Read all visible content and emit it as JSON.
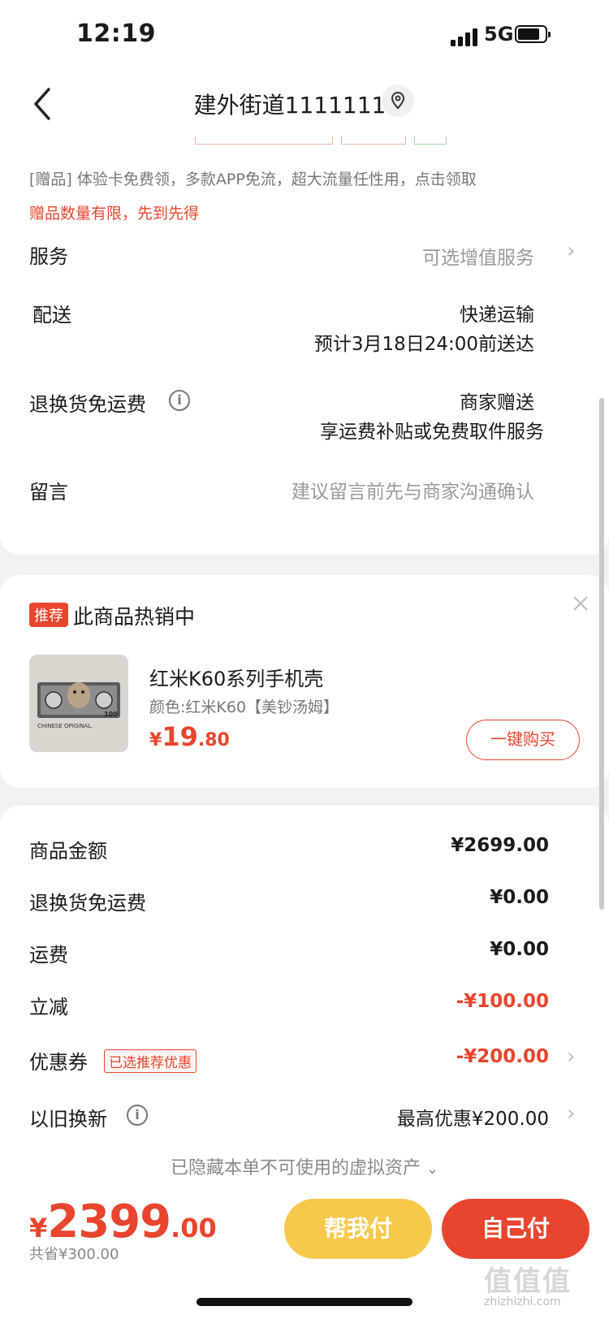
{
  "status": {
    "time": "12:19",
    "network": "5G"
  },
  "nav": {
    "title": "建外街道1111111"
  },
  "details": {
    "gift_text": "[赠品] 体验卡免费领，多款APP免流，超大流量任性用，点击领取",
    "gift_warning": "赠品数量有限，先到先得",
    "service": {
      "label": "服务",
      "value": "可选增值服务"
    },
    "delivery": {
      "label": "配送",
      "method": "快递运输",
      "eta": "预计3月18日24:00前送达"
    },
    "return_shipping": {
      "label": "退换货免运费",
      "line1": "商家赠送",
      "line2": "享运费补贴或免费取件服务"
    },
    "message": {
      "label": "留言",
      "placeholder": "建议留言前先与商家沟通确认"
    }
  },
  "recommend": {
    "badge": "推荐",
    "title": "此商品热销中",
    "product_name": "红米K60系列手机壳",
    "product_color": "颜色:红米K60【美钞汤姆】",
    "price_symbol": "¥",
    "price_int": "19",
    "price_dec": ".80",
    "buy_label": "一键购买",
    "thumb_text": "CHINESE OPIGINAL.",
    "thumb_value": "100"
  },
  "amounts": {
    "rows": [
      {
        "label": "商品金额",
        "value": "¥2699.00"
      },
      {
        "label": "退换货免运费",
        "value": "¥0.00"
      },
      {
        "label": "运费",
        "value": "¥0.00"
      },
      {
        "label": "立减",
        "value": "-¥100.00"
      },
      {
        "label": "优惠券",
        "badge": "已选推荐优惠",
        "value": "-¥200.00"
      },
      {
        "label": "以旧换新",
        "value": "最高优惠¥200.00"
      }
    ],
    "hidden_note": "已隐藏本单不可使用的虚拟资产"
  },
  "bottom": {
    "currency": "¥",
    "total_int": "2399",
    "total_dec": ".00",
    "saved": "共省¥300.00",
    "help_pay": "帮我付",
    "self_pay": "自己付",
    "watermark": "值值值",
    "watermark_url": "zhizhizhi.com"
  },
  "colors": {
    "accent": "#e8452e",
    "help_button": "#f6c84c",
    "background": "#f2f2f2"
  }
}
